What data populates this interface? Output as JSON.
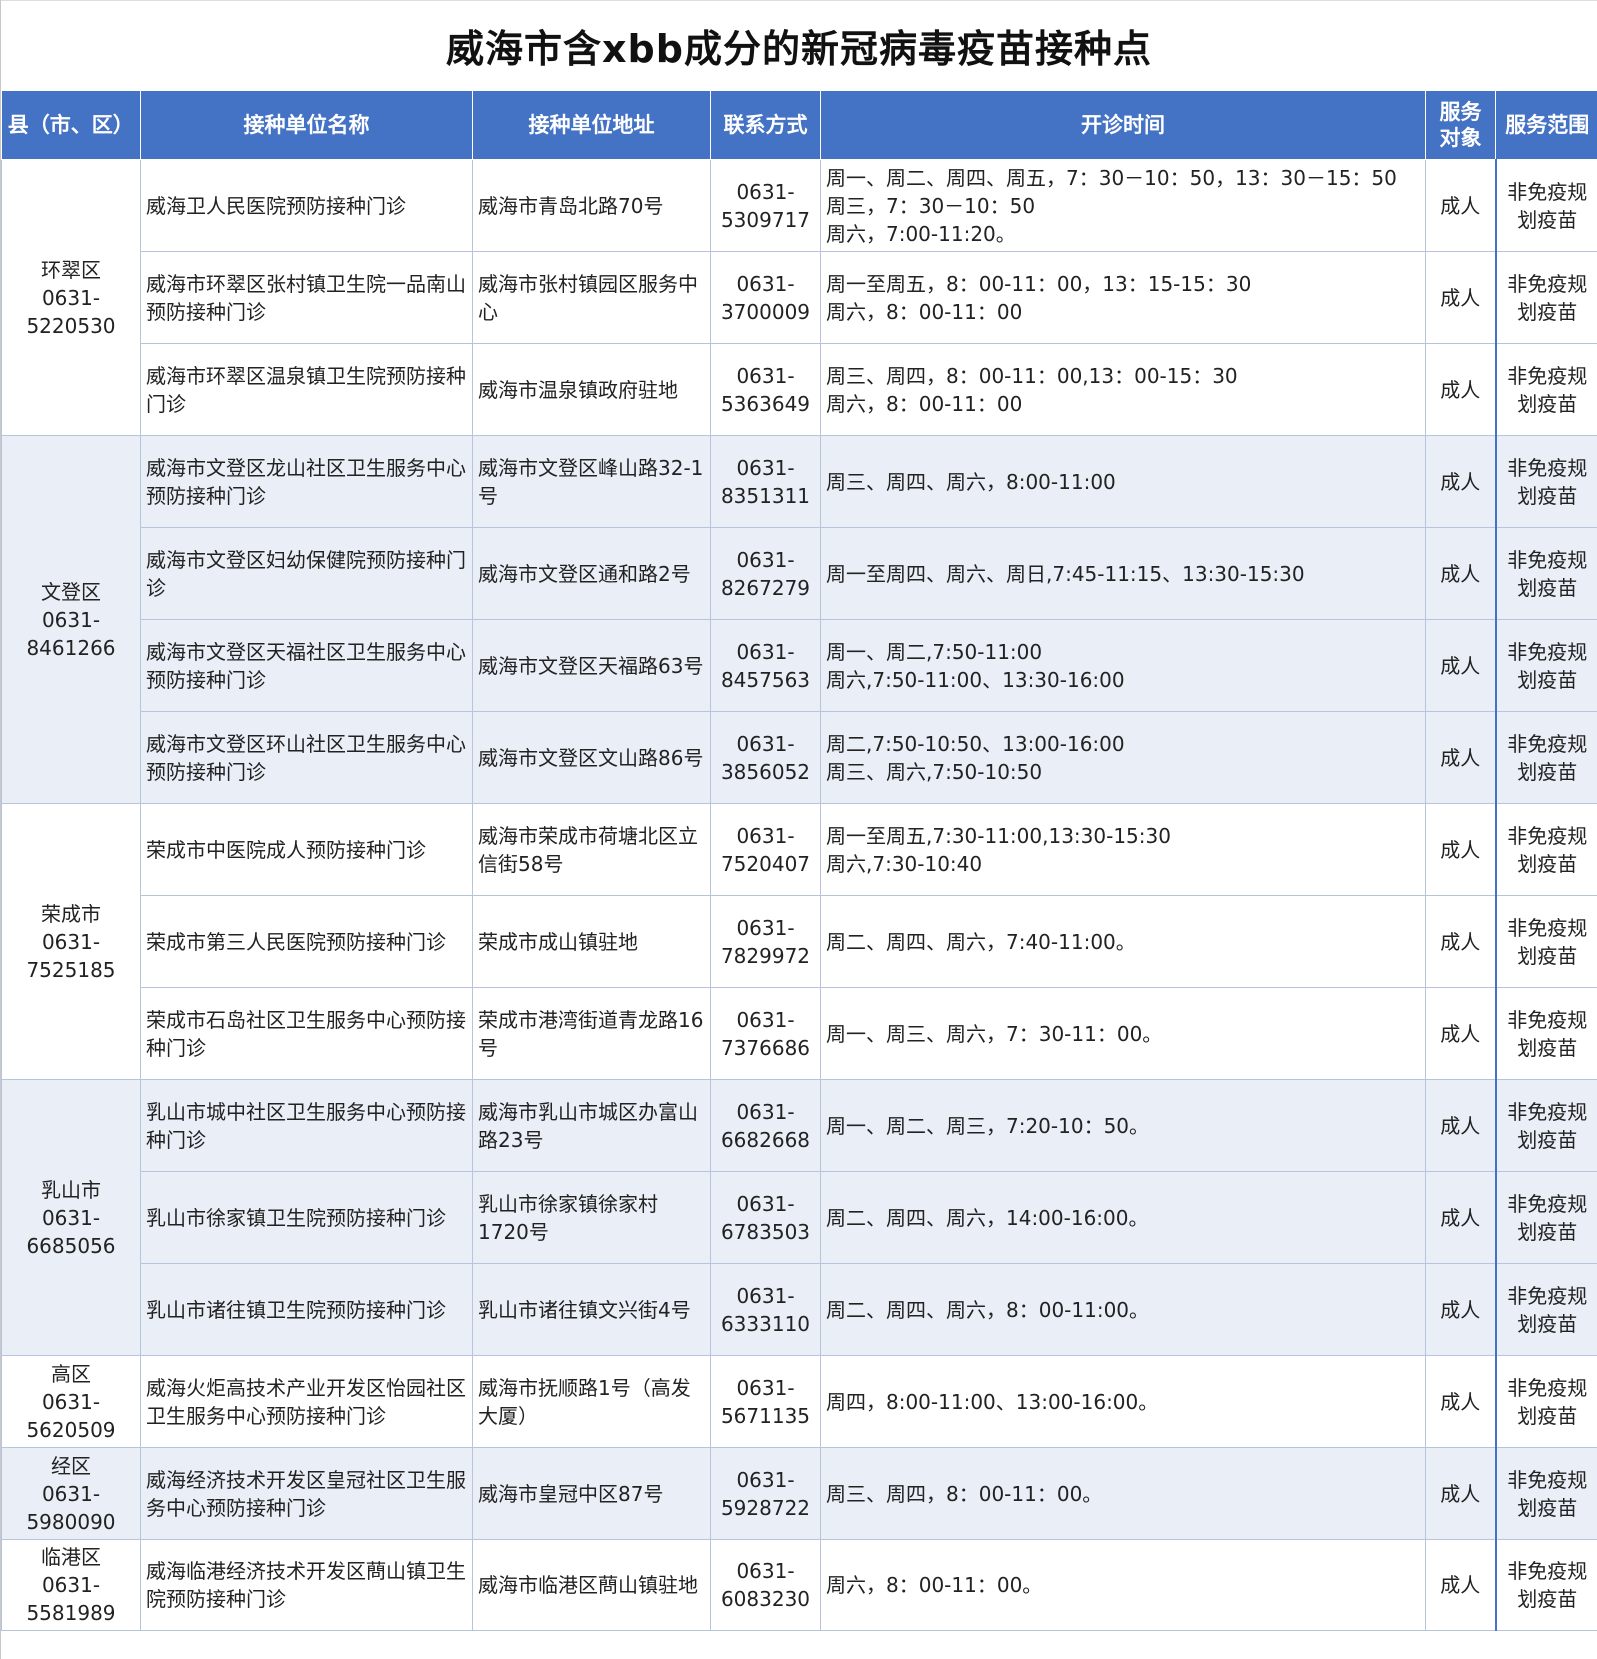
{
  "title": "威海市含xbb成分的新冠病毒疫苗接种点",
  "headers": [
    "县（市、区）",
    "接种单位名称",
    "接种单位地址",
    "联系方式",
    "开诊时间",
    "服务对象",
    "服务范围"
  ],
  "groups": [
    {
      "name": "环翠区",
      "phone": "0631-5220530",
      "rows": [
        {
          "unit": "威海卫人民医院预防接种门诊",
          "address": "威海市青岛北路70号",
          "phone": "0631-5309717",
          "hours": "周一、周二、周四、周五，7：30－10：50，13：30－15：50\n周三，7：30－10：50\n周六，7:00-11:20。",
          "target": "成人",
          "scope": "非免疫规划疫苗"
        },
        {
          "unit": "威海市环翠区张村镇卫生院一品南山预防接种门诊",
          "address": "威海市张村镇园区服务中心",
          "phone": "0631-3700009",
          "hours": "周一至周五，8：00-11：00，13：15-15：30\n周六，8：00-11：00",
          "target": "成人",
          "scope": "非免疫规划疫苗"
        },
        {
          "unit": "威海市环翠区温泉镇卫生院预防接种门诊",
          "address": "威海市温泉镇政府驻地",
          "phone": "0631-5363649",
          "hours": "周三、周四，8：00-11：00,13：00-15：30\n周六，8：00-11：00",
          "target": "成人",
          "scope": "非免疫规划疫苗"
        }
      ]
    },
    {
      "name": "文登区",
      "phone": "0631-8461266",
      "rows": [
        {
          "unit": "威海市文登区龙山社区卫生服务中心预防接种门诊",
          "address": "威海市文登区峰山路32-1号",
          "phone": "0631-8351311",
          "hours": "周三、周四、周六，8:00-11:00",
          "target": "成人",
          "scope": "非免疫规划疫苗"
        },
        {
          "unit": "威海市文登区妇幼保健院预防接种门诊",
          "address": "威海市文登区通和路2号",
          "phone": "0631-8267279",
          "hours": "周一至周四、周六、周日,7:45-11:15、13:30-15:30",
          "target": "成人",
          "scope": "非免疫规划疫苗"
        },
        {
          "unit": "威海市文登区天福社区卫生服务中心预防接种门诊",
          "address": "威海市文登区天福路63号",
          "phone": "0631-8457563",
          "hours": "周一、周二,7:50-11:00\n周六,7:50-11:00、13:30-16:00",
          "target": "成人",
          "scope": "非免疫规划疫苗"
        },
        {
          "unit": "威海市文登区环山社区卫生服务中心预防接种门诊",
          "address": "威海市文登区文山路86号",
          "phone": "0631-3856052",
          "hours": "周二,7:50-10:50、13:00-16:00\n周三、周六,7:50-10:50",
          "target": "成人",
          "scope": "非免疫规划疫苗"
        }
      ]
    },
    {
      "name": "荣成市",
      "phone": "0631-7525185",
      "rows": [
        {
          "unit": "荣成市中医院成人预防接种门诊",
          "address": "威海市荣成市荷塘北区立信街58号",
          "phone": "0631-7520407",
          "hours": "周一至周五,7:30-11:00,13:30-15:30\n周六,7:30-10:40",
          "target": "成人",
          "scope": "非免疫规划疫苗"
        },
        {
          "unit": "荣成市第三人民医院预防接种门诊",
          "address": "荣成市成山镇驻地",
          "phone": "0631-7829972",
          "hours": "周二、周四、周六，7:40-11:00。",
          "target": "成人",
          "scope": "非免疫规划疫苗"
        },
        {
          "unit": "荣成市石岛社区卫生服务中心预防接种门诊",
          "address": "荣成市港湾街道青龙路16号",
          "phone": "0631-7376686",
          "hours": "周一、周三、周六，7：30-11：00。",
          "target": "成人",
          "scope": "非免疫规划疫苗"
        }
      ]
    },
    {
      "name": "乳山市",
      "phone": "0631-6685056",
      "rows": [
        {
          "unit": "乳山市城中社区卫生服务中心预防接种门诊",
          "address": "威海市乳山市城区办富山路23号",
          "phone": "0631-6682668",
          "hours": "周一、周二、周三，7:20-10：50。",
          "target": "成人",
          "scope": "非免疫规划疫苗"
        },
        {
          "unit": "乳山市徐家镇卫生院预防接种门诊",
          "address": "乳山市徐家镇徐家村1720号",
          "phone": "0631-6783503",
          "hours": "周二、周四、周六，14:00-16:00。",
          "target": "成人",
          "scope": "非免疫规划疫苗"
        },
        {
          "unit": "乳山市诸往镇卫生院预防接种门诊",
          "address": "乳山市诸往镇文兴街4号",
          "phone": "0631-6333110",
          "hours": "周二、周四、周六，8：00-11:00。",
          "target": "成人",
          "scope": "非免疫规划疫苗"
        }
      ]
    },
    {
      "name": "高区",
      "phone": "0631-5620509",
      "rows": [
        {
          "unit": "威海火炬高技术产业开发区怡园社区卫生服务中心预防接种门诊",
          "address": "威海市抚顺路1号（高发大厦）",
          "phone": "0631-5671135",
          "hours": "周四，8:00-11:00、13:00-16:00。",
          "target": "成人",
          "scope": "非免疫规划疫苗"
        }
      ]
    },
    {
      "name": "经区",
      "phone": "0631-5980090",
      "rows": [
        {
          "unit": "威海经济技术开发区皇冠社区卫生服务中心预防接种门诊",
          "address": "威海市皇冠中区87号",
          "phone": "0631-5928722",
          "hours": "周三、周四，8：00-11：00。",
          "target": "成人",
          "scope": "非免疫规划疫苗"
        }
      ]
    },
    {
      "name": "临港区",
      "phone": "0631-5581989",
      "rows": [
        {
          "unit": "威海临港经济技术开发区蔄山镇卫生院预防接种门诊",
          "address": "威海市临港区蔄山镇驻地",
          "phone": "0631-6083230",
          "hours": "周六，8：00-11：00。",
          "target": "成人",
          "scope": "非免疫规划疫苗"
        }
      ]
    }
  ]
}
